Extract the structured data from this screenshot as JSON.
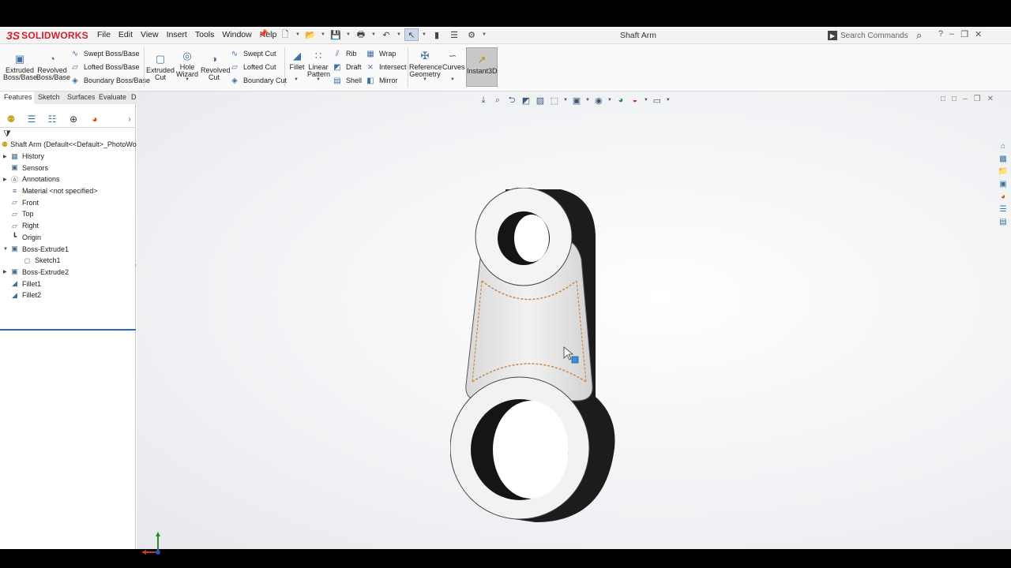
{
  "title_bar": {
    "logo_ds": "3S",
    "logo_text": "SOLIDWORKS",
    "menus": [
      "File",
      "Edit",
      "View",
      "Insert",
      "Tools",
      "Window",
      "Help"
    ],
    "document_title": "Shaft Arm",
    "search_placeholder": "Search Commands"
  },
  "ribbon": {
    "extruded_boss": "Extruded Boss/Base",
    "revolved_boss": "Revolved Boss/Base",
    "swept_boss": "Swept Boss/Base",
    "lofted_boss": "Lofted Boss/Base",
    "boundary_boss": "Boundary Boss/Base",
    "extruded_cut": "Extruded Cut",
    "hole_wizard": "Hole Wizard",
    "revolved_cut": "Revolved Cut",
    "swept_cut": "Swept Cut",
    "lofted_cut": "Lofted Cut",
    "boundary_cut": "Boundary Cut",
    "fillet": "Fillet",
    "linear_pattern": "Linear Pattern",
    "rib": "Rib",
    "draft": "Draft",
    "shell": "Shell",
    "wrap": "Wrap",
    "intersect": "Intersect",
    "mirror": "Mirror",
    "reference_geometry": "Reference Geometry",
    "curves": "Curves",
    "instant3d": "Instant3D"
  },
  "tabs": [
    "Features",
    "Sketch",
    "Surfaces",
    "Evaluate",
    "DimXpert"
  ],
  "feature_tree": {
    "root": "Shaft Arm  (Default<<Default>_PhotoWorks",
    "items": [
      {
        "label": "History",
        "expandable": true,
        "indent": 0
      },
      {
        "label": "Sensors",
        "expandable": false,
        "indent": 0
      },
      {
        "label": "Annotations",
        "expandable": true,
        "indent": 0
      },
      {
        "label": "Material <not specified>",
        "expandable": false,
        "indent": 0
      },
      {
        "label": "Front",
        "expandable": false,
        "indent": 0
      },
      {
        "label": "Top",
        "expandable": false,
        "indent": 0
      },
      {
        "label": "Right",
        "expandable": false,
        "indent": 0
      },
      {
        "label": "Origin",
        "expandable": false,
        "indent": 0
      },
      {
        "label": "Boss-Extrude1",
        "expandable": true,
        "expanded": true,
        "indent": 0
      },
      {
        "label": "Sketch1",
        "expandable": false,
        "indent": 1
      },
      {
        "label": "Boss-Extrude2",
        "expandable": true,
        "indent": 0
      },
      {
        "label": "Fillet1",
        "expandable": false,
        "indent": 0
      },
      {
        "label": "Fillet2",
        "expandable": false,
        "indent": 0
      }
    ]
  },
  "colors": {
    "brand": "#d3202a",
    "selection": "#2e6bbf",
    "edge_highlight": "#c8874a"
  }
}
